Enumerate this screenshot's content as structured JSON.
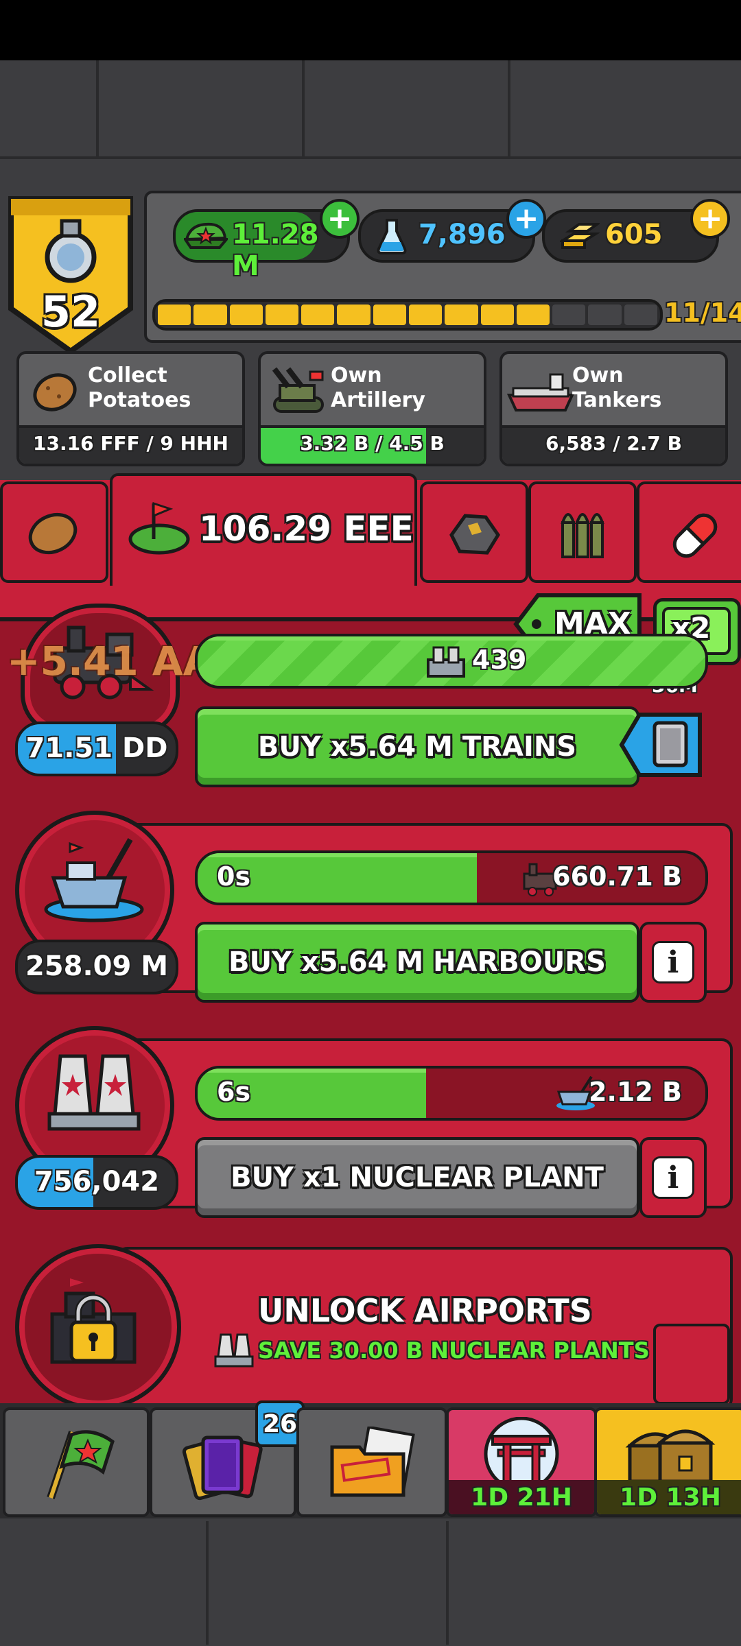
{
  "player": {
    "level": "52"
  },
  "resources": {
    "cash": "11.28 M",
    "science": "7,896",
    "gold": "605"
  },
  "level_progress": {
    "label": "11/14",
    "value": 11,
    "max": 14
  },
  "quests": [
    {
      "icon": "potato-icon",
      "label": "Collect Potatoes",
      "progress": "13.16 FFF / 9 HHH",
      "fill": 0.0
    },
    {
      "icon": "artillery-icon",
      "label": "Own Artillery",
      "progress": "3.32 B / 4.5 B",
      "fill": 0.74
    },
    {
      "icon": "tanker-icon",
      "label": "Own Tankers",
      "progress": "6,583 / 2.7 B",
      "fill": 0.0
    }
  ],
  "tabs": {
    "active_value": "106.29 EEE"
  },
  "multiplier": {
    "max_label": "MAX",
    "boost_label": "x2",
    "boost_timer": "10H 36M"
  },
  "units": [
    {
      "name": "trains",
      "floating_gain": "+5.41 AA",
      "count": "71.51 DD",
      "count_fill": 0.6,
      "progress_left": "",
      "progress_right": "439",
      "progress_fill": 1.0,
      "buy_label": "BUY x5.64 M TRAINS",
      "enabled": true
    },
    {
      "name": "harbours",
      "count": "258.09 M",
      "count_fill": 0.0,
      "progress_left": "0s",
      "progress_right": "660.71 B",
      "progress_fill": 0.55,
      "buy_label": "BUY x5.64 M HARBOURS",
      "enabled": true
    },
    {
      "name": "nuclear_plants",
      "count": "756,042",
      "count_fill": 0.7,
      "progress_left": "6s",
      "progress_right": "2.12 B",
      "progress_fill": 0.45,
      "buy_label": "BUY x1 NUCLEAR PLANT",
      "enabled": false
    }
  ],
  "unlock": {
    "title": "UNLOCK AIRPORTS",
    "subtitle": "SAVE 30.00 B NUCLEAR PLANTS"
  },
  "bottom_nav": {
    "cards_badge": "26",
    "event_timer": "1D 21H",
    "chest_timer": "1D 13H"
  },
  "colors": {
    "red": "#c8203a",
    "green": "#57c83a",
    "blue": "#2aa3e6",
    "gold": "#f5c020"
  }
}
